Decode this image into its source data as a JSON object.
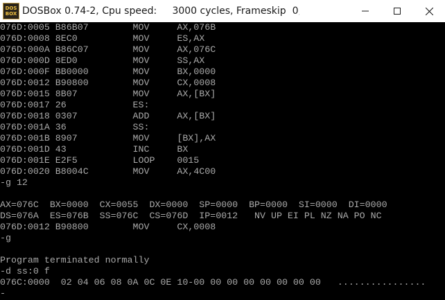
{
  "window": {
    "icon_line1": "DOS",
    "icon_line2": "BOX",
    "title": "DOSBox 0.74-2, Cpu speed:     3000 cycles, Frameskip  0, P...",
    "controls": {
      "minimize": "minimize-icon",
      "maximize": "maximize-icon",
      "close": "close-icon"
    }
  },
  "console": {
    "text_color": "#aaaaaa",
    "background": "#000000",
    "lines": [
      "076D:0005 B86B07        MOV     AX,076B",
      "076D:0008 8EC0          MOV     ES,AX",
      "076D:000A B86C07        MOV     AX,076C",
      "076D:000D 8ED0          MOV     SS,AX",
      "076D:000F BB0000        MOV     BX,0000",
      "076D:0012 B90800        MOV     CX,0008",
      "076D:0015 8B07          MOV     AX,[BX]",
      "076D:0017 26            ES:",
      "076D:0018 0307          ADD     AX,[BX]",
      "076D:001A 36            SS:",
      "076D:001B 8907          MOV     [BX],AX",
      "076D:001D 43            INC     BX",
      "076D:001E E2F5          LOOP    0015",
      "076D:0020 B8004C        MOV     AX,4C00",
      "-g 12",
      "",
      "AX=076C  BX=0000  CX=0055  DX=0000  SP=0000  BP=0000  SI=0000  DI=0000",
      "DS=076A  ES=076B  SS=076C  CS=076D  IP=0012   NV UP EI PL NZ NA PO NC",
      "076D:0012 B90800        MOV     CX,0008",
      "-g",
      "",
      "Program terminated normally",
      "-d ss:0 f",
      "076C:0000  02 04 06 08 0A 0C 0E 10-00 00 00 00 00 00 00 00   ................",
      "-"
    ]
  }
}
